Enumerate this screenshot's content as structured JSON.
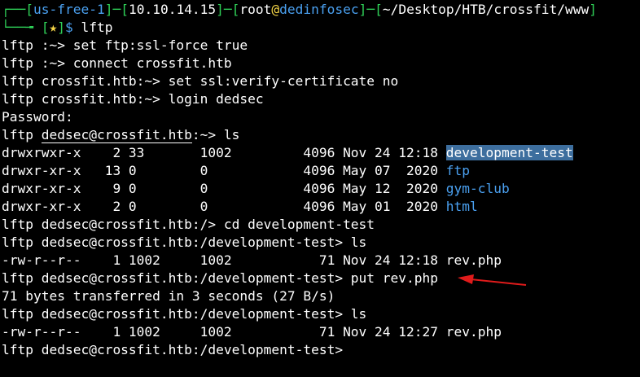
{
  "prompt": {
    "box_top": "┌──",
    "box_bottom": "└──╼",
    "location": "us-free-1",
    "ip": "10.10.14.15",
    "user": "root",
    "at": "@",
    "host": "dedinfosec",
    "path": "~/Desktop/HTB/crossfit/www",
    "star": "★",
    "dollar": "$",
    "command": "lftp"
  },
  "lines": {
    "l1": "lftp :~> set ftp:ssl-force true",
    "l2": "lftp :~> connect crossfit.htb",
    "l3": "lftp crossfit.htb:~> set ssl:verify-certificate no",
    "l4": "lftp crossfit.htb:~> login dedsec",
    "l5": "Password:",
    "l6_prefix": "lftp ",
    "l6_under": "dedsec@crossfit.htb",
    "l6_suffix": ":~> ls"
  },
  "listing1": [
    {
      "meta": "drwxrwxr-x    2 33       1002         4096 Nov 24 12:18 ",
      "name": "development-test"
    },
    {
      "meta": "drwxr-xr-x   13 0        0            4096 May 07  2020 ",
      "name": "ftp"
    },
    {
      "meta": "drwxr-xr-x    9 0        0            4096 May 12  2020 ",
      "name": "gym-club"
    },
    {
      "meta": "drwxr-xr-x    2 0        0            4096 May 01  2020 ",
      "name": "html"
    }
  ],
  "lines2": {
    "cd": "lftp dedsec@crossfit.htb:/> cd development-test",
    "ls1": "lftp dedsec@crossfit.htb:/development-test> ls",
    "file1": "-rw-r--r--    1 1002     1002           71 Nov 24 12:18 rev.php",
    "put": "lftp dedsec@crossfit.htb:/development-test> put rev.php",
    "transfer": "71 bytes transferred in 3 seconds (27 B/s)",
    "ls2": "lftp dedsec@crossfit.htb:/development-test> ls",
    "file2": "-rw-r--r--    1 1002     1002           71 Nov 24 12:27 rev.php",
    "final": "lftp dedsec@crossfit.htb:/development-test>"
  },
  "colors": {
    "background": "#000000",
    "prompt_green": "#2fd158",
    "dir_blue": "#4aa0f0",
    "selection": "#3d6e9e",
    "arrow_red": "#e01b1b"
  }
}
